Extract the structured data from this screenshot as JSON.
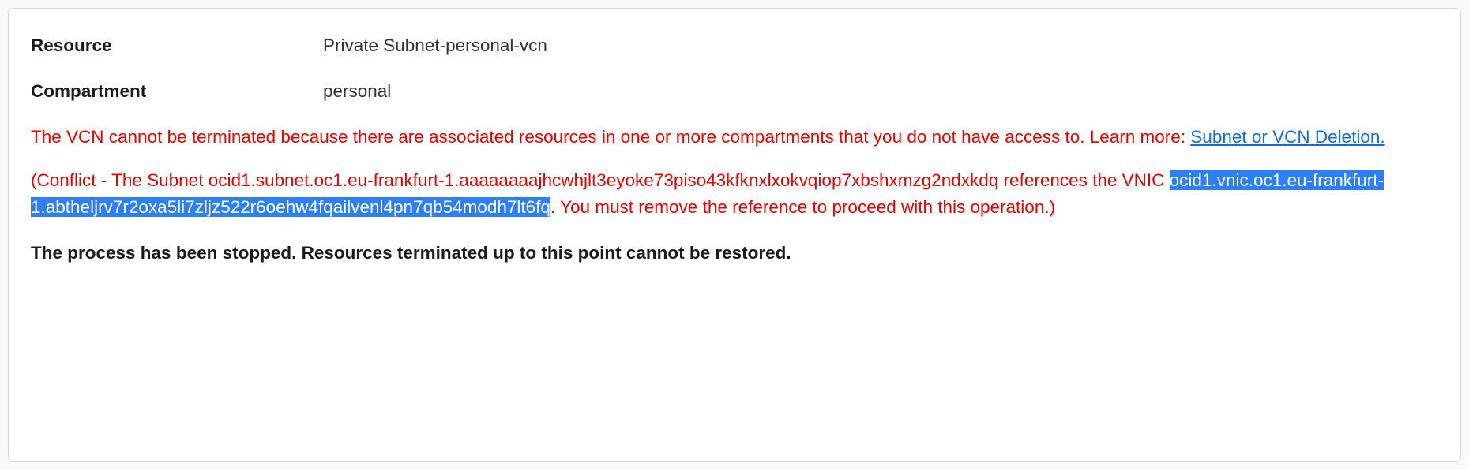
{
  "fields": {
    "resource_label": "Resource",
    "resource_value": "Private Subnet-personal-vcn",
    "compartment_label": "Compartment",
    "compartment_value": "personal"
  },
  "error": {
    "prefix": "The VCN cannot be terminated because there are associated resources in one or more compartments that you do not have access to. Learn more: ",
    "link_text": "Subnet or VCN Deletion."
  },
  "conflict": {
    "part1": "(Conflict - The Subnet ocid1.subnet.oc1.eu-frankfurt-1.aaaaaaaajhcwhjlt3eyoke73piso43kfknxlxokvqiop7xbshxmzg2ndxkdq references the VNIC ",
    "highlighted_ocid": "ocid1.vnic.oc1.eu-frankfurt-1.abtheljrv7r2oxa5li7zljz522r6oehw4fqailvenl4pn7qb54modh7lt6fq",
    "part2": ". You must remove the reference to proceed with this operation.)"
  },
  "stopped_message": "The process has been stopped. Resources terminated up to this point cannot be restored."
}
